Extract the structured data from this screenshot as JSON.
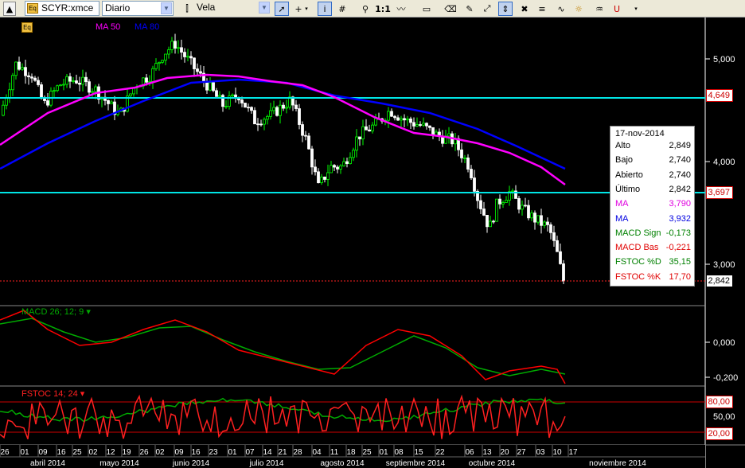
{
  "toolbar": {
    "symbol": "SCYR:xmce",
    "period": "Diario",
    "chart_type": "Vela",
    "one_to_one": "1:1",
    "icons": [
      "scroll-up-icon",
      "equity-icon",
      "chart-type-icon",
      "pointer-icon",
      "crosshair-icon",
      "info-icon",
      "grid-icon",
      "zoom-icon",
      "one-to-one-button",
      "wave-icon",
      "rectangle-icon",
      "eraser-icon",
      "pencil-icon",
      "fit-icon",
      "delete-icon",
      "price-list-icon",
      "auto-scale-icon",
      "indicator-icon",
      "magnet-icon",
      "more-icon"
    ]
  },
  "chart": {
    "ma_labels": {
      "ma50": "MA 50",
      "ma80": "MA 80"
    },
    "colors": {
      "ma50": "#ff00ff",
      "ma80": "#0000ff",
      "hline": "#00e5e5",
      "macd_signal": "#00aa00",
      "macd_line": "#ff0000",
      "candle_up": "#00ff00",
      "candle_down": "#ffffff"
    },
    "y_ticks": [
      "5,000",
      "4,000",
      "3,000"
    ],
    "price_labels": {
      "upper": "4,649",
      "lower": "3,697",
      "last": "2,842"
    },
    "macd_title": "MACD 26; 12; 9",
    "macd_ticks": [
      "0,000",
      "-0,200"
    ],
    "stoch_title": "FSTOC 14; 24",
    "stoch_labels": {
      "high": "80,00",
      "mid": "50,00",
      "low": "20,00"
    },
    "day_ticks": [
      "26",
      "01",
      "09",
      "16",
      "25",
      "02",
      "12",
      "19",
      "26",
      "02",
      "09",
      "16",
      "23",
      "01",
      "07",
      "14",
      "21",
      "28",
      "04",
      "11",
      "18",
      "25",
      "01",
      "08",
      "15",
      "22",
      "06",
      "13",
      "20",
      "27",
      "03",
      "10",
      "17"
    ],
    "months": [
      "abril 2014",
      "mayo 2014",
      "junio 2014",
      "julio 2014",
      "agosto 2014",
      "septiembre 2014",
      "octubre 2014",
      "noviembre 2014"
    ]
  },
  "infobox": {
    "date": "17-nov-2014",
    "rows": [
      {
        "label": "Alto",
        "value": "2,849",
        "color": "#000000"
      },
      {
        "label": "Bajo",
        "value": "2,740",
        "color": "#000000"
      },
      {
        "label": "Abierto",
        "value": "2,740",
        "color": "#000000"
      },
      {
        "label": "Último",
        "value": "2,842",
        "color": "#000000"
      },
      {
        "label": "MA",
        "value": "3,790",
        "color": "#e000e0"
      },
      {
        "label": "MA",
        "value": "3,932",
        "color": "#0000e0"
      },
      {
        "label": "MACD Sign",
        "value": "-0,173",
        "color": "#008000"
      },
      {
        "label": "MACD Bas",
        "value": "-0,221",
        "color": "#e00000"
      },
      {
        "label": "FSTOC %D",
        "value": "35,15",
        "color": "#008000"
      },
      {
        "label": "FSTOC %K",
        "value": "17,70",
        "color": "#e00000"
      }
    ]
  }
}
